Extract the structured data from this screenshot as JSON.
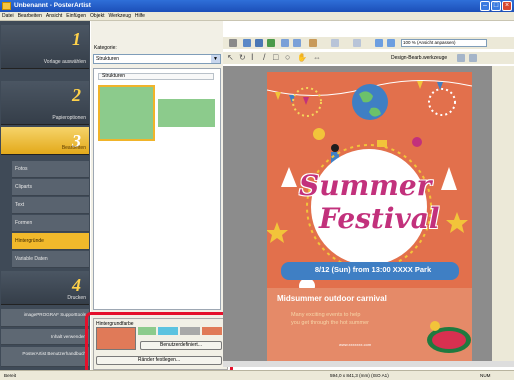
{
  "window": {
    "title": "Unbenannt - PosterArtist"
  },
  "menu": [
    "Datei",
    "Bearbeiten",
    "Ansicht",
    "Einfügen",
    "Objekt",
    "Werkzeug",
    "Hilfe"
  ],
  "nav": {
    "steps": [
      {
        "num": "1",
        "label": "Vorlage auswählen"
      },
      {
        "num": "2",
        "label": "Papieroptionen"
      },
      {
        "num": "3",
        "label": "Bearbeiten"
      },
      {
        "num": "4",
        "label": "Drucken"
      }
    ],
    "subitems": [
      "Fotos",
      "Cliparts",
      "Text",
      "Formen",
      "Hintergründe",
      "Variable Daten"
    ],
    "extra": [
      "imagePROGRAF Supporttools",
      "Inhalt verwenden",
      "PosterArtist Benutzerhandbuch"
    ]
  },
  "category": {
    "label": "Kategorie:",
    "selected": "Strukturen",
    "list_header": "Strukturen"
  },
  "background": {
    "label": "Hintergrundfarbe",
    "custom_button": "Benutzerdefiniert...",
    "border_button": "Ränder festlegen..."
  },
  "toolbar": {
    "zoom": "100 % (Ansicht anpassen)",
    "design_tools": "Design-Bearb.werkzeuge"
  },
  "poster": {
    "title_line1": "Summer",
    "title_line2": "Festival",
    "date_line": "8/12 (Sun) from 13:00  XXXX Park",
    "subtitle": "Midsummer outdoor carnival",
    "body_line1": "Many exciting events to help",
    "body_line2": "you get through the hot summer",
    "url": "www.xxxxxxx.com"
  },
  "status": {
    "ready": "Bereit",
    "size": "594,0 x 841,3 (mm) (ISO A1)",
    "num": "NUM"
  },
  "colors": {
    "poster_bg": "#e2704c",
    "title_pink": "#c2317c",
    "date_band": "#3f7fc4",
    "swatch_green": "#8ccb8c",
    "highlight": "#e5102c"
  }
}
